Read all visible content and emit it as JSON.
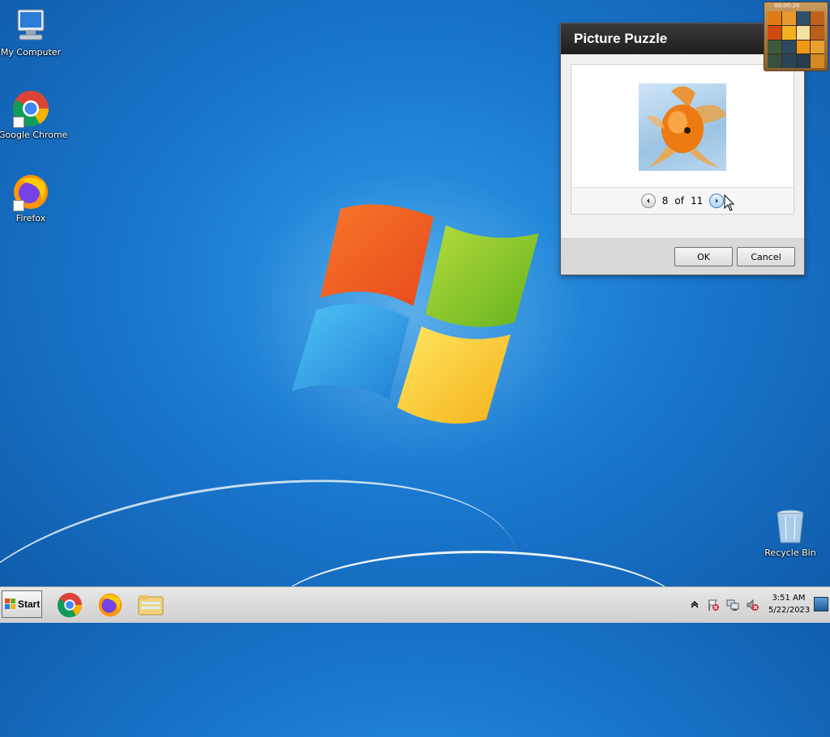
{
  "desktop": {
    "icons": [
      {
        "label": "My Computer"
      },
      {
        "label": "Google Chrome"
      },
      {
        "label": "Firefox"
      },
      {
        "label": "Recycle Bin"
      }
    ]
  },
  "dialog": {
    "title": "Picture Puzzle",
    "pager": {
      "current": "8",
      "of_label": "of",
      "total": "11"
    },
    "ok_label": "OK",
    "cancel_label": "Cancel"
  },
  "gadget": {
    "timer": "00:00:20"
  },
  "taskbar": {
    "start_label": "Start",
    "apps": [
      "chrome-icon",
      "firefox-icon",
      "file-explorer-icon"
    ],
    "tray_icons": [
      "show-hidden-icons",
      "action-center-flag-icon",
      "network-icon",
      "volume-muted-icon"
    ],
    "clock_time": "3:51 AM",
    "clock_date": "5/22/2023"
  },
  "colors": {
    "desktop_bg": "#1a78cf",
    "dialog_title_bg": "#1e1e1e",
    "taskbar_bg": "#d6d6d6"
  }
}
